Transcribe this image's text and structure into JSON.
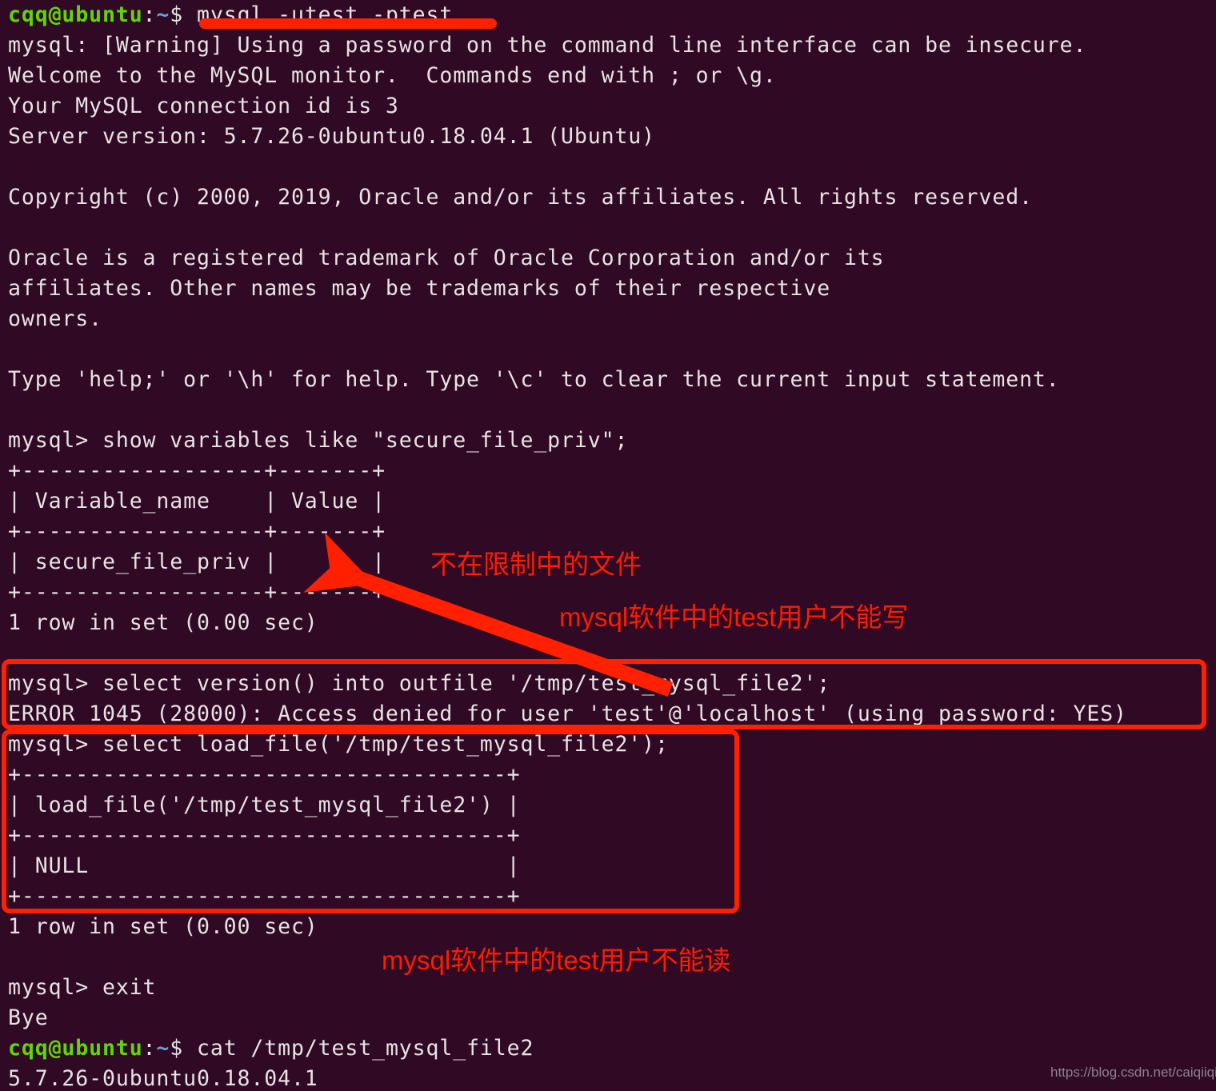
{
  "terminal": {
    "background_color": "#300a24",
    "text_color": "#e8e2e4",
    "prompt_user_color": "#5fd700",
    "prompt_path_color": "#6a9fd8",
    "annotation_color": "#ff1a00",
    "prompt": {
      "user_host": "cqq@ubuntu",
      "colon": ":",
      "path": "~",
      "dollar": "$"
    },
    "lines": [
      {
        "type": "prompt",
        "command": " mysql -utest -ptest"
      },
      {
        "type": "out",
        "text": "mysql: [Warning] Using a password on the command line interface can be insecure."
      },
      {
        "type": "out",
        "text": "Welcome to the MySQL monitor.  Commands end with ; or \\g."
      },
      {
        "type": "out",
        "text": "Your MySQL connection id is 3"
      },
      {
        "type": "out",
        "text": "Server version: 5.7.26-0ubuntu0.18.04.1 (Ubuntu)"
      },
      {
        "type": "out",
        "text": ""
      },
      {
        "type": "out",
        "text": "Copyright (c) 2000, 2019, Oracle and/or its affiliates. All rights reserved."
      },
      {
        "type": "out",
        "text": ""
      },
      {
        "type": "out",
        "text": "Oracle is a registered trademark of Oracle Corporation and/or its"
      },
      {
        "type": "out",
        "text": "affiliates. Other names may be trademarks of their respective"
      },
      {
        "type": "out",
        "text": "owners."
      },
      {
        "type": "out",
        "text": ""
      },
      {
        "type": "out",
        "text": "Type 'help;' or '\\h' for help. Type '\\c' to clear the current input statement."
      },
      {
        "type": "out",
        "text": ""
      },
      {
        "type": "out",
        "text": "mysql> show variables like \"secure_file_priv\";"
      },
      {
        "type": "out",
        "text": "+------------------+-------+"
      },
      {
        "type": "out",
        "text": "| Variable_name    | Value |"
      },
      {
        "type": "out",
        "text": "+------------------+-------+"
      },
      {
        "type": "out",
        "text": "| secure_file_priv |       |"
      },
      {
        "type": "out",
        "text": "+------------------+-------+"
      },
      {
        "type": "out",
        "text": "1 row in set (0.00 sec)"
      },
      {
        "type": "out",
        "text": ""
      },
      {
        "type": "out",
        "text": "mysql> select version() into outfile '/tmp/test_mysql_file2';"
      },
      {
        "type": "out",
        "text": "ERROR 1045 (28000): Access denied for user 'test'@'localhost' (using password: YES)"
      },
      {
        "type": "out",
        "text": "mysql> select load_file('/tmp/test_mysql_file2');"
      },
      {
        "type": "out",
        "text": "+------------------------------------+"
      },
      {
        "type": "out",
        "text": "| load_file('/tmp/test_mysql_file2') |"
      },
      {
        "type": "out",
        "text": "+------------------------------------+"
      },
      {
        "type": "out",
        "text": "| NULL                               |"
      },
      {
        "type": "out",
        "text": "+------------------------------------+"
      },
      {
        "type": "out",
        "text": "1 row in set (0.00 sec)"
      },
      {
        "type": "out",
        "text": ""
      },
      {
        "type": "out",
        "text": "mysql> exit"
      },
      {
        "type": "out",
        "text": "Bye"
      },
      {
        "type": "prompt",
        "command": " cat /tmp/test_mysql_file2"
      },
      {
        "type": "out",
        "text": "5.7.26-0ubuntu0.18.04.1"
      }
    ]
  },
  "annotations": {
    "file_note": "不在限制中的文件",
    "write_note": "mysql软件中的test用户不能写",
    "read_note": "mysql软件中的test用户不能读",
    "underline_target": "mysql -utest -ptest",
    "box_error_target": "select version() into outfile / ERROR 1045",
    "box_loadfile_target": "select load_file result table",
    "arrow_target": "secure_file_priv empty value cell"
  },
  "watermark": {
    "text": "https://blog.csdn.net/caiqiiqi"
  }
}
